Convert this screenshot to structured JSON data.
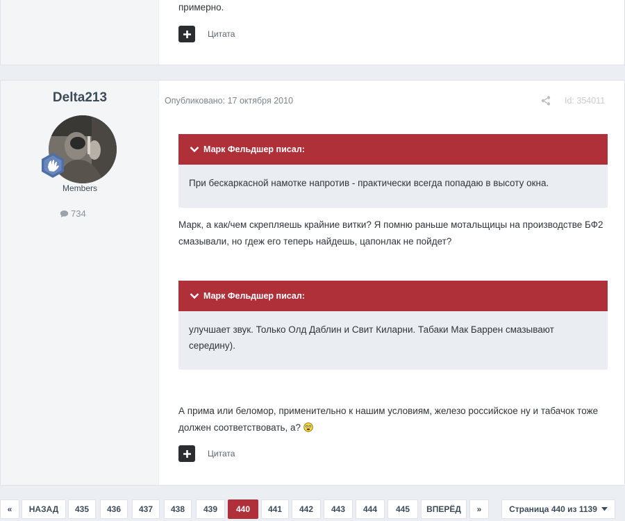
{
  "previous_post": {
    "text_tail": "примерно.",
    "quote_label": "Цитата"
  },
  "post": {
    "author": "Delta213",
    "member_group": "Members",
    "post_count": "734",
    "published": "Опубликовано: 17 октября 2010",
    "post_id": "Id: 354011",
    "quote1": {
      "header": "Марк Фельдшер писал:",
      "body": "При бескаркасной намотке напротив - практически всегда попадаю в высоту окна."
    },
    "paragraph1": "Марк, а как/чем скрепляешь крайние витки? Я помню раньше мотальщицы на производстве БФ2 смазывали, но гдеж его теперь найдешь, цапонлак не пойдет?",
    "quote2": {
      "header": "Марк Фельдшер писал:",
      "body": "улучшает звук. Только Олд Даблин и Свит Киларни. Табаки Мак Баррен смазывают середину)."
    },
    "paragraph2": "А прима или беломор, применительно к нашим условиям, железо российское ну и табачок тоже должен соответствовать, а?",
    "quote_label": "Цитата"
  },
  "pagination": {
    "first": "«",
    "back": "НАЗАД",
    "pages": [
      "435",
      "436",
      "437",
      "438",
      "439",
      "440",
      "441",
      "442",
      "443",
      "444",
      "445"
    ],
    "current": "440",
    "next": "ВПЕРЁД",
    "last": "»",
    "page_indicator": "Страница 440 из 1139"
  },
  "colors": {
    "accent": "#b0303a",
    "author_bg": "#f3f5f7",
    "page_bg": "#ebeef2"
  }
}
